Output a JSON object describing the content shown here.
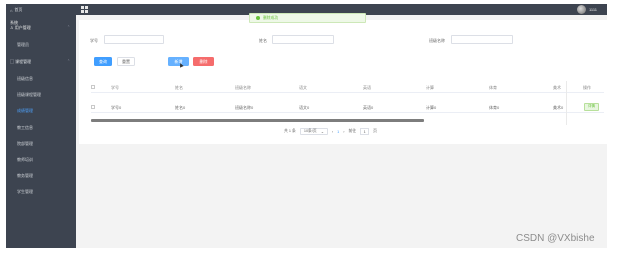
{
  "topbar": {
    "home_label": "首页",
    "username": "1111"
  },
  "sidebar": {
    "user_group": {
      "title_line1": "系统",
      "title_line2": "用户管理"
    },
    "items": [
      {
        "label": "管理员"
      },
      {
        "label": "课程管理",
        "group": true
      },
      {
        "label": "班级信息"
      },
      {
        "label": "班级课程管理"
      },
      {
        "label": "成绩管理",
        "active": true
      },
      {
        "label": "教工信息"
      },
      {
        "label": "院部管理"
      },
      {
        "label": "教师培训"
      },
      {
        "label": "教务管理"
      },
      {
        "label": "学生管理"
      }
    ]
  },
  "toast": {
    "message": "删除成功"
  },
  "search": {
    "fields": [
      {
        "label": "学号",
        "value": "",
        "placeholder": ""
      },
      {
        "label": "姓名",
        "value": "",
        "placeholder": ""
      },
      {
        "label": "班级名称",
        "value": "",
        "placeholder": ""
      }
    ],
    "search_label": "查询",
    "reset_label": "重置",
    "add_label": "新增",
    "delete_label": "删除"
  },
  "table": {
    "headers": [
      "学号",
      "姓名",
      "班级名称",
      "语文",
      "英语",
      "计算",
      "体育",
      "美术",
      "操作"
    ],
    "rows": [
      [
        "学号0",
        "姓名0",
        "班级名称0",
        "语文0",
        "英语0",
        "计算0",
        "体育0",
        "美术0"
      ]
    ],
    "detail_label": "详情"
  },
  "pagination": {
    "total": "共 1 条",
    "page_size": "10条/页",
    "prev": "‹",
    "current": "1",
    "next": "›",
    "goto_label": "前往",
    "goto_value": "1",
    "page_suffix": "页"
  },
  "watermark": "CSDN @VXbishe",
  "colors": {
    "sidebar_bg": "#3d4450",
    "primary": "#409eff",
    "danger": "#f56c6c",
    "success": "#67c23a"
  }
}
